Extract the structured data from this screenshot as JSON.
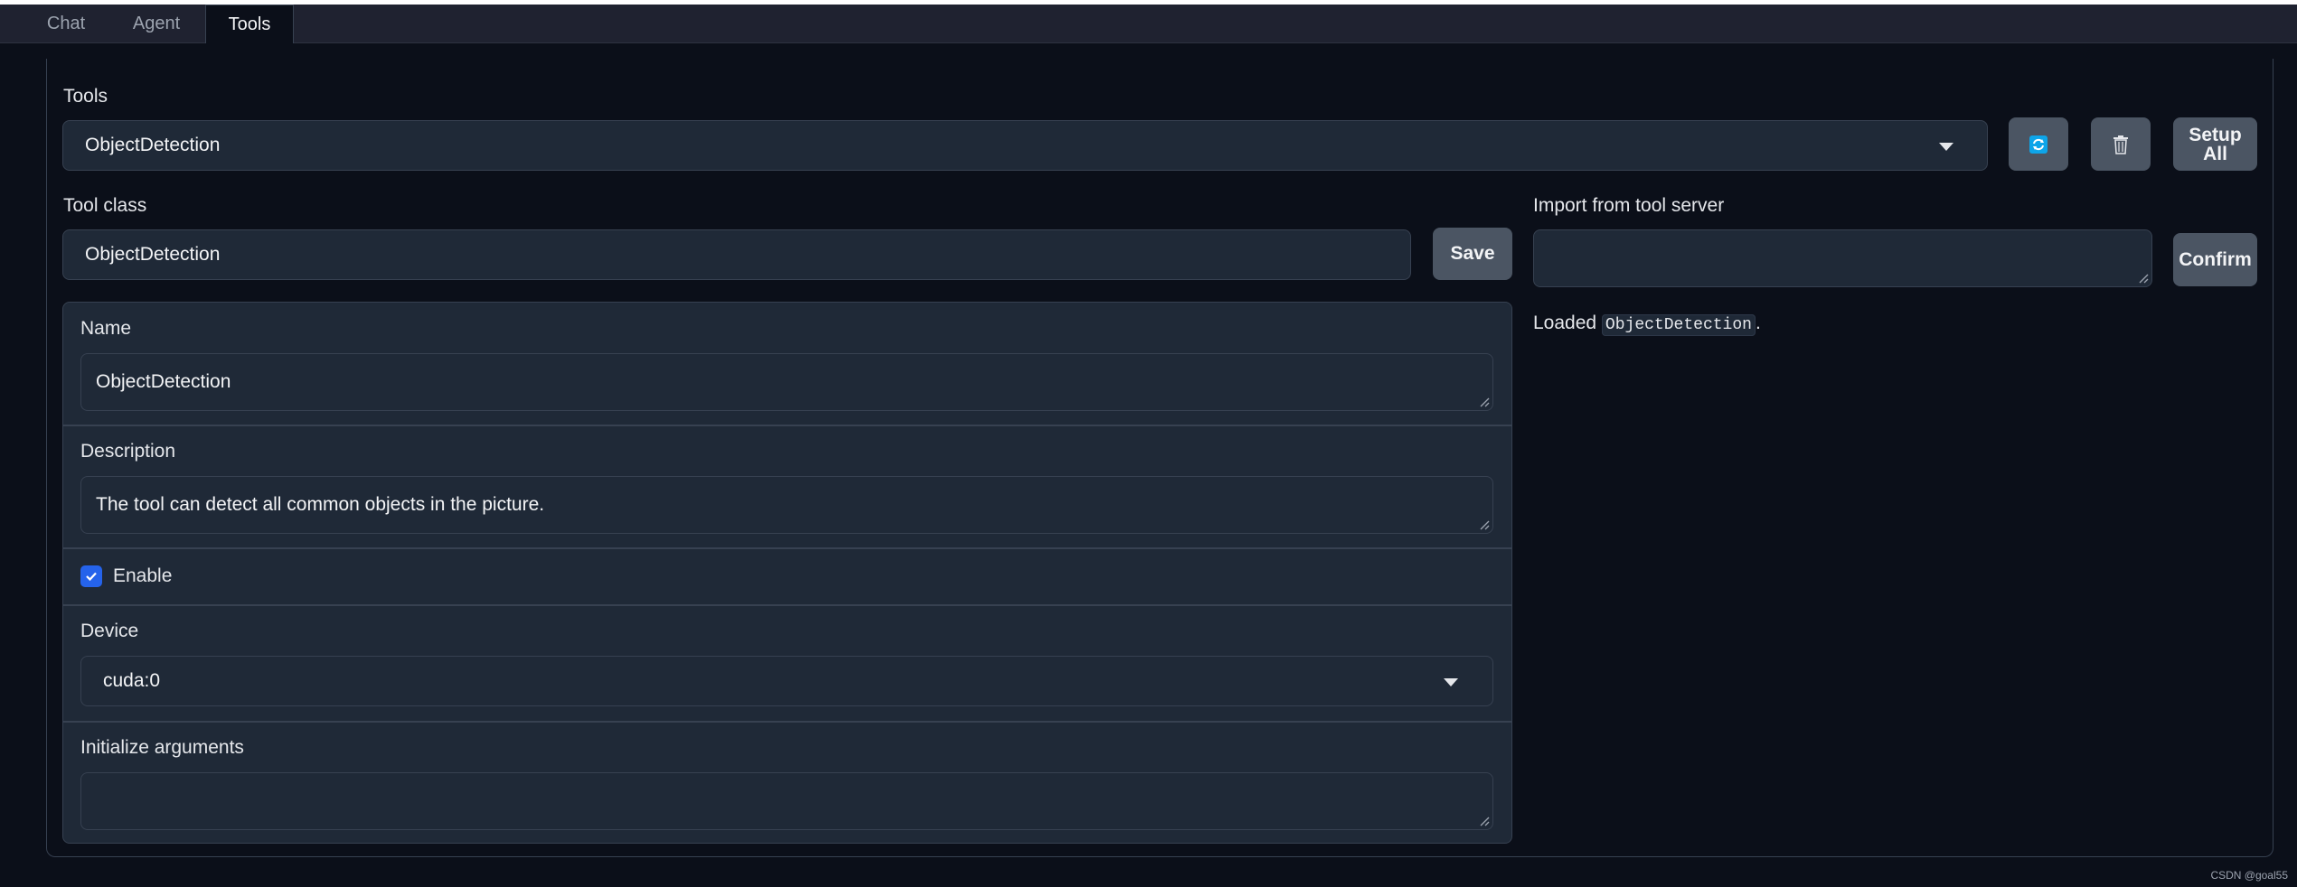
{
  "tabs": [
    {
      "label": "Chat",
      "active": false
    },
    {
      "label": "Agent",
      "active": false
    },
    {
      "label": "Tools",
      "active": true
    }
  ],
  "tools": {
    "label": "Tools",
    "selected": "ObjectDetection",
    "refresh_icon": "refresh-icon",
    "delete_icon": "trash-icon",
    "setup_all_label": "Setup\nAll"
  },
  "tool_class": {
    "label": "Tool class",
    "value": "ObjectDetection",
    "save_label": "Save"
  },
  "import": {
    "label": "Import from tool server",
    "value": "",
    "confirm_label": "Confirm",
    "status_prefix": "Loaded ",
    "status_code": "ObjectDetection",
    "status_suffix": "."
  },
  "config": {
    "name_label": "Name",
    "name_value": "ObjectDetection",
    "description_label": "Description",
    "description_value": "The tool can detect all common objects in the picture.",
    "enable_label": "Enable",
    "enable_checked": true,
    "device_label": "Device",
    "device_value": "cuda:0",
    "init_args_label": "Initialize arguments",
    "init_args_value": ""
  },
  "colors": {
    "background": "#0b0f19",
    "field": "#1f2937",
    "border": "#374151",
    "button": "#4b5563",
    "checkbox": "#2563eb",
    "refresh_icon": "#0ea5e9"
  },
  "footer": "CSDN @goal55"
}
